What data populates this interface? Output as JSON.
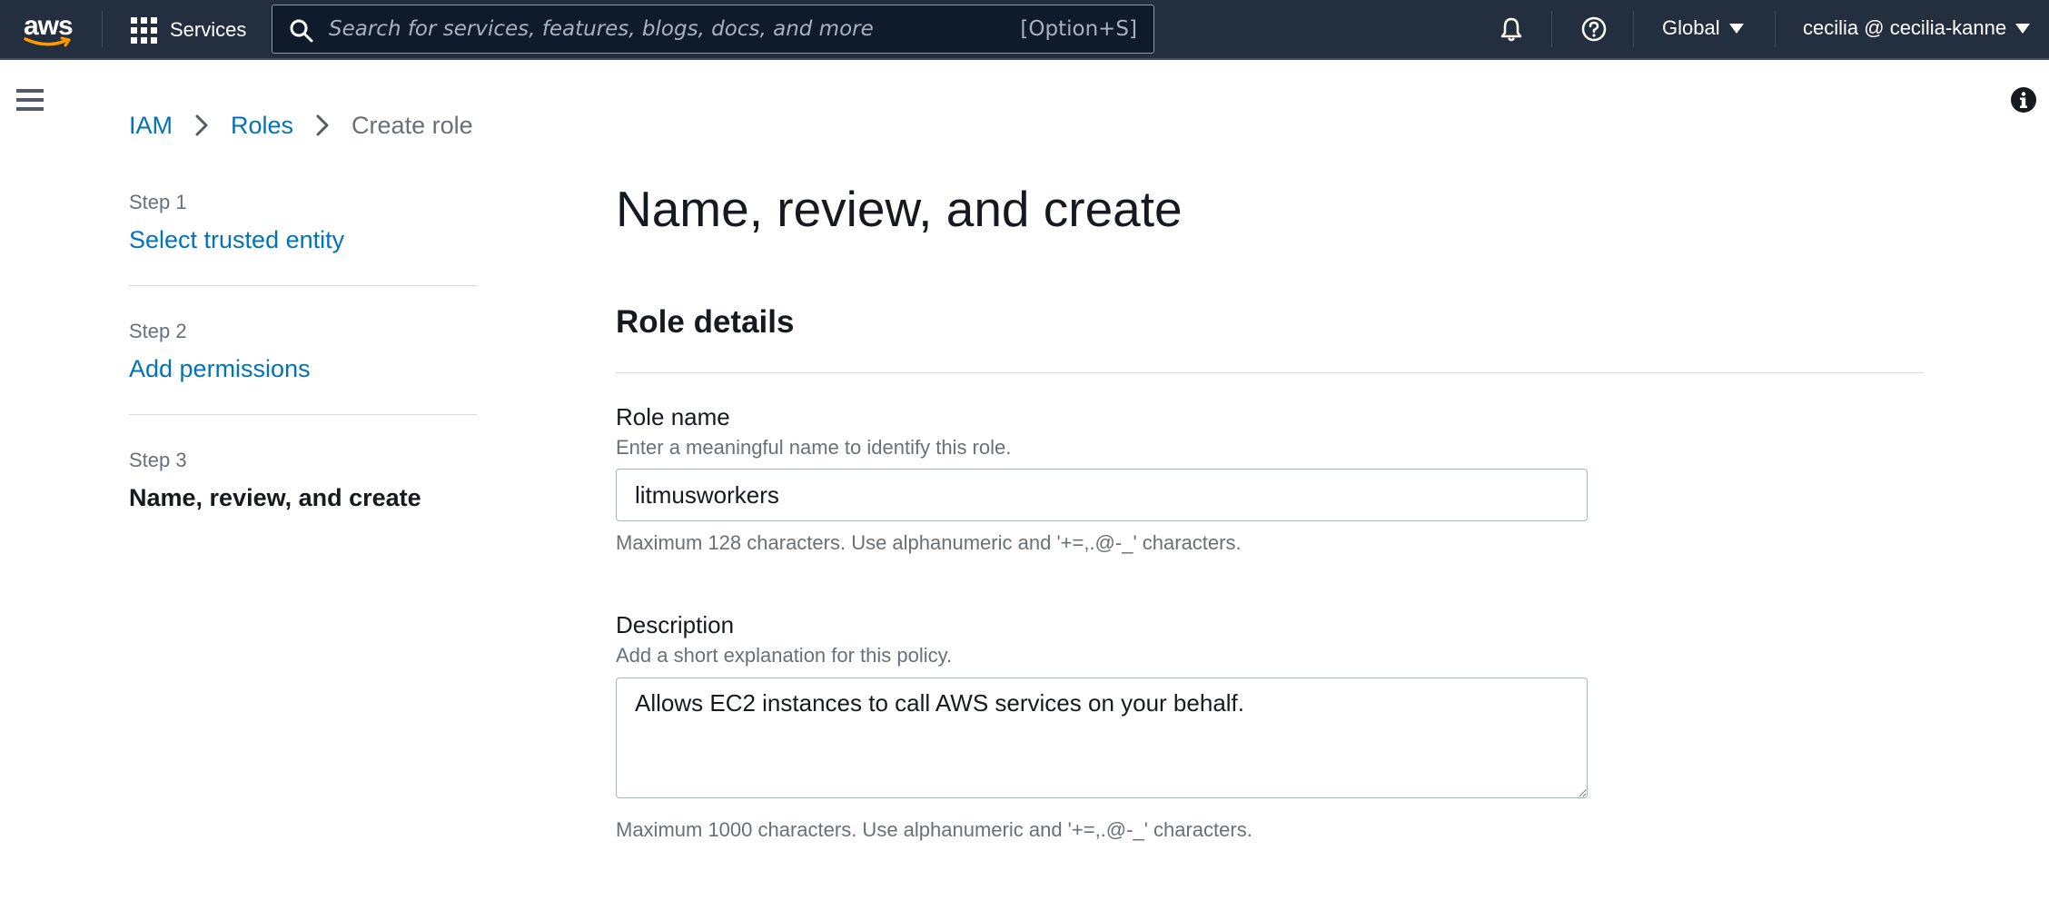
{
  "topnav": {
    "logo_text": "aws",
    "services_label": "Services",
    "search_placeholder": "Search for services, features, blogs, docs, and more",
    "search_shortcut": "[Option+S]",
    "region_label": "Global",
    "account_label": "cecilia @ cecilia-kanne",
    "icons": [
      "grid-icon",
      "search-icon",
      "bell-icon",
      "help-icon",
      "caret-down-icon"
    ]
  },
  "breadcrumb": {
    "items": [
      "IAM",
      "Roles"
    ],
    "current": "Create role"
  },
  "steps": [
    {
      "number": "Step 1",
      "label": "Select trusted entity"
    },
    {
      "number": "Step 2",
      "label": "Add permissions"
    },
    {
      "number": "Step 3",
      "label": "Name, review, and create"
    }
  ],
  "page": {
    "title": "Name, review, and create",
    "section_title": "Role details"
  },
  "role_name": {
    "label": "Role name",
    "description": "Enter a meaningful name to identify this role.",
    "value": "litmusworkers",
    "constraint": "Maximum 128 characters. Use alphanumeric and '+=,.@-_' characters."
  },
  "description": {
    "label": "Description",
    "description": "Add a short explanation for this policy.",
    "value": "Allows EC2 instances to call AWS services on your behalf.",
    "constraint": "Maximum 1000 characters. Use alphanumeric and '+=,.@-_' characters."
  },
  "colors": {
    "nav_bg": "#232f3e",
    "link": "#0073bb",
    "brand_orange": "#ff9900",
    "muted_text": "#687078"
  }
}
